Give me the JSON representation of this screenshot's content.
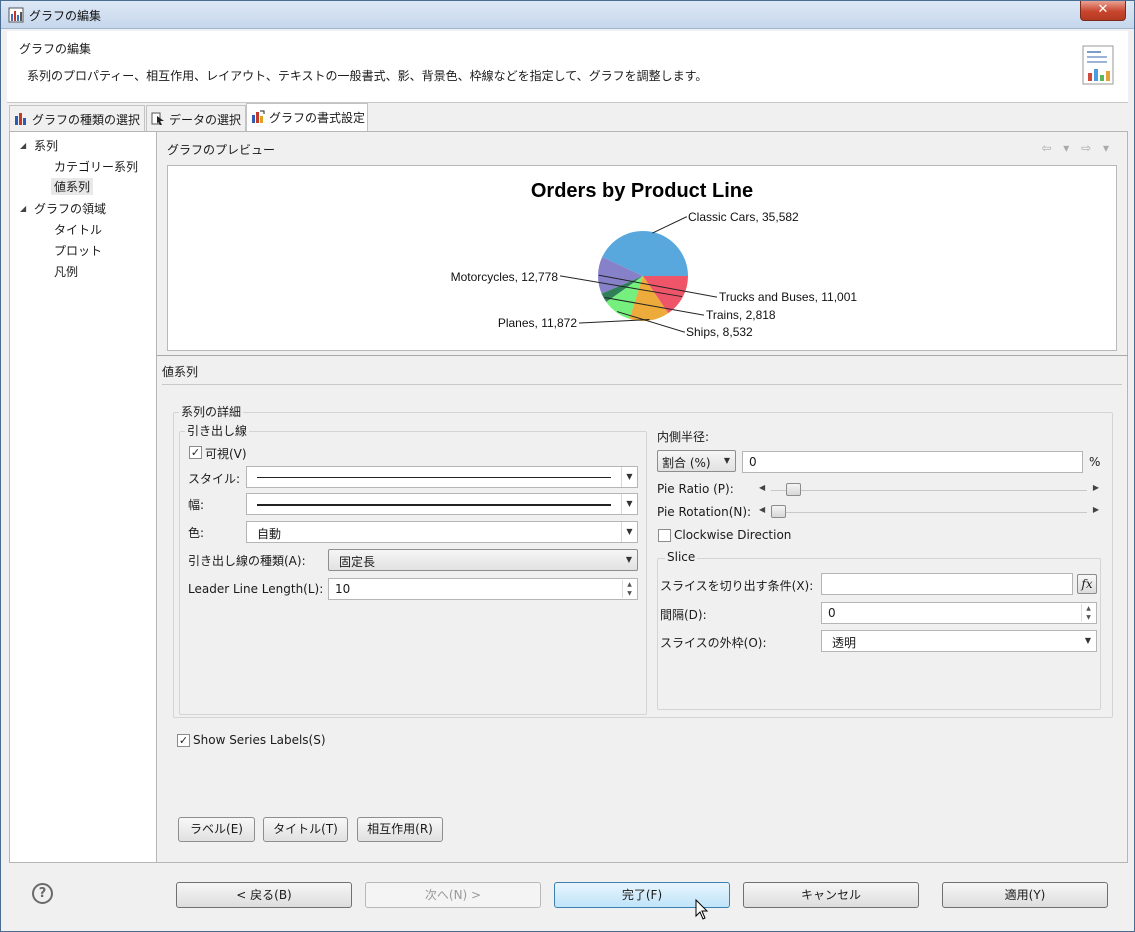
{
  "window": {
    "title": "グラフの編集",
    "close": "✕"
  },
  "header": {
    "title": "グラフの編集",
    "description": "系列のプロパティー、相互作用、レイアウト、テキストの一般書式、影、背景色、枠線などを指定して、グラフを調整します。"
  },
  "tabs": [
    {
      "label": "グラフの種類の選択",
      "icon": "chart-type-icon"
    },
    {
      "label": "データの選択",
      "icon": "data-select-icon"
    },
    {
      "label": "グラフの書式設定",
      "icon": "chart-format-icon",
      "active": true
    }
  ],
  "tree": {
    "items": [
      {
        "label": "系列",
        "level": 0,
        "expanded": true
      },
      {
        "label": "カテゴリー系列",
        "level": 1
      },
      {
        "label": "値系列",
        "level": 1,
        "selected": true
      },
      {
        "label": "グラフの領域",
        "level": 0,
        "expanded": true
      },
      {
        "label": "タイトル",
        "level": 1
      },
      {
        "label": "プロット",
        "level": 1
      },
      {
        "label": "凡例",
        "level": 1
      }
    ]
  },
  "preview": {
    "label": "グラフのプレビュー",
    "nav_back": "⇦ ▾",
    "nav_forward": "⇨ ▾"
  },
  "chart_data": {
    "type": "pie",
    "title": "Orders by Product Line",
    "slices": [
      {
        "label": "Classic Cars",
        "value": 35582,
        "display": "Classic Cars, 35,582",
        "color": "#58a8de"
      },
      {
        "label": "Trucks and Buses",
        "value": 11001,
        "display": "Trucks and Buses, 11,001",
        "color": "#8681c9"
      },
      {
        "label": "Trains",
        "value": 2818,
        "display": "Trains, 2,818",
        "color": "#2f7f58"
      },
      {
        "label": "Ships",
        "value": 8532,
        "display": "Ships, 8,532",
        "color": "#75f07e"
      },
      {
        "label": "Planes",
        "value": 11872,
        "display": "Planes, 11,872",
        "color": "#ecab3a"
      },
      {
        "label": "Motorcycles",
        "value": 12778,
        "display": "Motorcycles, 12,778",
        "color": "#ee5569"
      }
    ],
    "legend": "none"
  },
  "section": {
    "title": "値系列",
    "details_group": "系列の詳細"
  },
  "leader": {
    "group": "引き出し線",
    "visible_label": "可視(V)",
    "visible_checked": true,
    "style_label": "スタイル:",
    "width_label": "幅:",
    "color_label": "色:",
    "color_value": "自動",
    "type_label": "引き出し線の種類(A):",
    "type_value": "固定長",
    "length_label": "Leader Line Length(L):",
    "length_value": "10"
  },
  "right_settings": {
    "inner_radius_label": "内側半径:",
    "inner_radius_mode": "割合 (%)",
    "inner_radius_value": "0",
    "percent_unit": "%",
    "pie_ratio_label": "Pie Ratio (P):",
    "pie_ratio_level": 0.05,
    "pie_rotation_label": "Pie Rotation(N):",
    "pie_rotation_level": 0.0,
    "clockwise_label": "Clockwise Direction",
    "clockwise_checked": false
  },
  "slice": {
    "group": "Slice",
    "condition_label": "スライスを切り出す条件(X):",
    "condition_value": "",
    "fx": "fx",
    "distance_label": "間隔(D):",
    "distance_value": "0",
    "outline_label": "スライスの外枠(O):",
    "outline_value": "透明"
  },
  "show_series_labels": {
    "label": "Show Series Labels(S)",
    "checked": true
  },
  "panel_buttons": {
    "label": "ラベル(E)",
    "title": "タイトル(T)",
    "interactivity": "相互作用(R)"
  },
  "footer": {
    "help": "?",
    "back": "< 戻る(B)",
    "next": "次へ(N) >",
    "finish": "完了(F)",
    "cancel": "キャンセル",
    "apply": "適用(Y)"
  }
}
